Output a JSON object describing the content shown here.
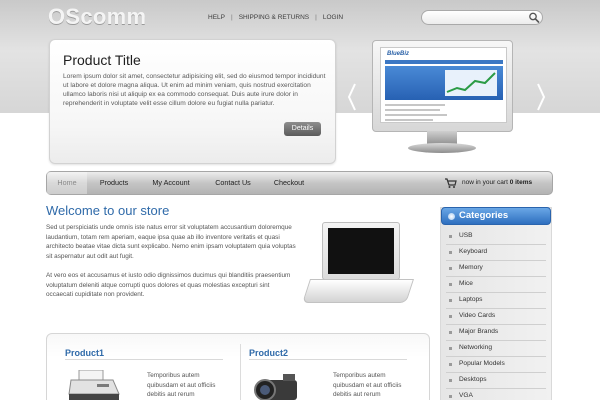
{
  "header": {
    "logo": "OScomm",
    "links": [
      "HELP",
      "SHIPPING & RETURNS",
      "LOGIN"
    ],
    "separator": "|",
    "search_placeholder": ""
  },
  "featured": {
    "title": "Product Title",
    "description": "Lorem ipsum dolor sit amet, consectetur adipisicing elit, sed do eiusmod tempor incididunt ut labore et dolore magna aliqua. Ut enim ad minim veniam, quis nostrud exercitation ullamco laboris nisi ut aliquip ex ea commodo consequat. Duis aute irure dolor in reprehenderit in voluptate velit esse cillum dolore eu fugiat nulla pariatur.",
    "details_label": "Details",
    "screen_brand": "BlueBiz"
  },
  "nav": {
    "items": [
      "Home",
      "Products",
      "My Account",
      "Contact Us",
      "Checkout"
    ],
    "cart_prefix": "now in your cart",
    "cart_count": "0 items"
  },
  "welcome": {
    "title": "Welcome to our store",
    "paragraph1": "Sed ut perspiciatis unde omnis iste natus error sit voluptatem accusantium doloremque laudantium, totam rem aperiam, eaque ipsa quae ab illo inventore veritatis et quasi architecto beatae vitae dicta sunt explicabo. Nemo enim ipsam voluptatem quia voluptas sit aspernatur aut odit aut fugit.",
    "paragraph2": "At vero eos et accusamus et iusto odio dignissimos ducimus qui blanditiis praesentium voluptatum deleniti atque corrupti quos dolores et quas molestias excepturi sint occaecati cupiditate non provident."
  },
  "products": [
    {
      "title": "Product1",
      "text": "Temporibus autem quibusdam et aut officiis debitis aut rerum"
    },
    {
      "title": "Product2",
      "text": "Temporibus autem quibusdam et aut officiis debitis aut rerum"
    }
  ],
  "categories": {
    "title": "Categories",
    "items": [
      "USB",
      "Keyboard",
      "Memory",
      "Mice",
      "Laptops",
      "Video Cards",
      "Major Brands",
      "Networking",
      "Popular Models",
      "Desktops",
      "VGA"
    ]
  },
  "colors": {
    "accent_blue": "#2f6aa9",
    "category_header": "#2e6fbf"
  }
}
